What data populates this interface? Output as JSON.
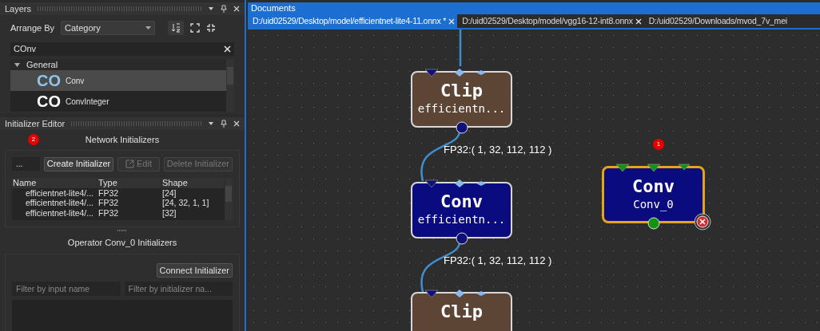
{
  "layers": {
    "title": "Layers",
    "arrange_label": "Arrange By",
    "arrange_value": "Category",
    "search_value": "COnv",
    "groups": [
      {
        "label": "General",
        "expanded": true,
        "children": [
          {
            "glyph": "CO",
            "label": "Conv",
            "selected": true
          },
          {
            "glyph": "CO",
            "label": "ConvInteger",
            "selected": false
          }
        ]
      }
    ]
  },
  "initializer_editor": {
    "title": "Initializer Editor",
    "network_title": "Network Initializers",
    "badge": "2",
    "name_value": "...",
    "buttons": [
      {
        "label": "Create Initializer",
        "disabled": false,
        "kind": "plain"
      },
      {
        "label": "Edit",
        "disabled": true,
        "kind": "edit"
      },
      {
        "label": "Delete Initializer",
        "disabled": true,
        "kind": "plain"
      }
    ],
    "columns": [
      "Name",
      "Type",
      "Shape"
    ],
    "rows": [
      [
        "efficientnet-lite4/...",
        "FP32",
        "[24]"
      ],
      [
        "efficientnet-lite4/...",
        "FP32",
        "[24, 32, 1, 1]"
      ],
      [
        "efficientnet-lite4/...",
        "FP32",
        "[32]"
      ]
    ],
    "operator_title": "Operator Conv_0 Initializers",
    "connect_button": "Connect Initializer",
    "filters": [
      {
        "placeholder": "Filter by input name"
      },
      {
        "placeholder": "Filter by initializer na..."
      }
    ]
  },
  "documents": {
    "title": "Documents",
    "tabs": [
      {
        "label": "D:/uid02529/Desktop/model/efficientnet-lite4-11.onnx *",
        "selected": true,
        "closable": true
      },
      {
        "label": "D:/uid02529/Desktop/model/vgg16-12-int8.onnx",
        "selected": false,
        "closable": true
      },
      {
        "label": "D:/uid02529/Downloads/mvod_7v_mei",
        "selected": false,
        "closable": false
      }
    ]
  },
  "canvas": {
    "nodes": [
      {
        "op": "Clip",
        "name": "efficientn...",
        "kind": "clip",
        "selected": false,
        "error": false
      },
      {
        "op": "Conv",
        "name": "efficientn...",
        "kind": "conv",
        "selected": false,
        "error": false
      },
      {
        "op": "Clip",
        "kind": "clip",
        "selected": false,
        "error": false
      },
      {
        "op": "Conv",
        "name": "Conv_0",
        "kind": "conv",
        "selected": true,
        "error": true,
        "badge": "1"
      }
    ],
    "edge_labels": [
      "FP32:( 1, 32, 112, 112 )",
      "FP32:( 1, 32, 112, 112 )"
    ]
  }
}
